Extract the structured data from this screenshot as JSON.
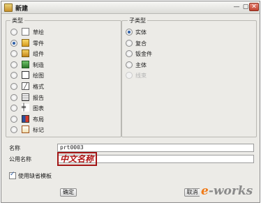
{
  "window": {
    "title": "新建",
    "close": "✕"
  },
  "type_group": {
    "title": "类型",
    "selected_index": 1,
    "items": [
      {
        "label": "草绘",
        "icon": "sketch-icon"
      },
      {
        "label": "零件",
        "icon": "part-icon"
      },
      {
        "label": "组件",
        "icon": "assembly-icon"
      },
      {
        "label": "制造",
        "icon": "manufacturing-icon"
      },
      {
        "label": "绘图",
        "icon": "drawing-icon"
      },
      {
        "label": "格式",
        "icon": "format-icon"
      },
      {
        "label": "报告",
        "icon": "report-icon"
      },
      {
        "label": "图表",
        "icon": "diagram-icon"
      },
      {
        "label": "布局",
        "icon": "layout-icon"
      },
      {
        "label": "标记",
        "icon": "markup-icon"
      }
    ]
  },
  "subtype_group": {
    "title": "子类型",
    "selected_index": 0,
    "items": [
      {
        "label": "实体",
        "enabled": true
      },
      {
        "label": "复合",
        "enabled": true
      },
      {
        "label": "钣金件",
        "enabled": true
      },
      {
        "label": "主体",
        "enabled": true
      },
      {
        "label": "线束",
        "enabled": false
      }
    ]
  },
  "name": {
    "label": "名称",
    "value": "prt0003"
  },
  "common_name": {
    "label": "公用名称",
    "value": "",
    "overlay_text": "中文名称",
    "overlay_color": "#b01515"
  },
  "default_template": {
    "label": "使用缺省模板",
    "checked": true
  },
  "buttons": {
    "ok": "确定",
    "cancel": "取消"
  },
  "watermark": {
    "first": "e",
    "rest": "-works"
  }
}
